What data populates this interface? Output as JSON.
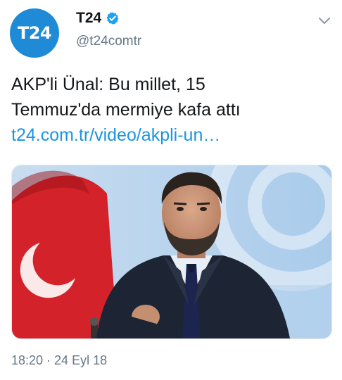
{
  "account": {
    "avatar_text": "T24",
    "display_name": "T24",
    "handle": "@t24comtr",
    "verified_icon": "verified-badge-icon",
    "avatar_color": "#1f8ad6"
  },
  "tweet": {
    "text_line_1": "AKP'li Ünal: Bu millet, 15",
    "text_line_2": "Temmuz'da mermiye kafa attı",
    "link": "t24.com.tr/video/akpli-un…",
    "link_color": "#1b95e0"
  },
  "media": {
    "description_icon": "photo-icon"
  },
  "meta": {
    "timestamp": "18:20 · 24 Eyl 18"
  },
  "menu": {
    "icon": "chevron-down-icon"
  }
}
